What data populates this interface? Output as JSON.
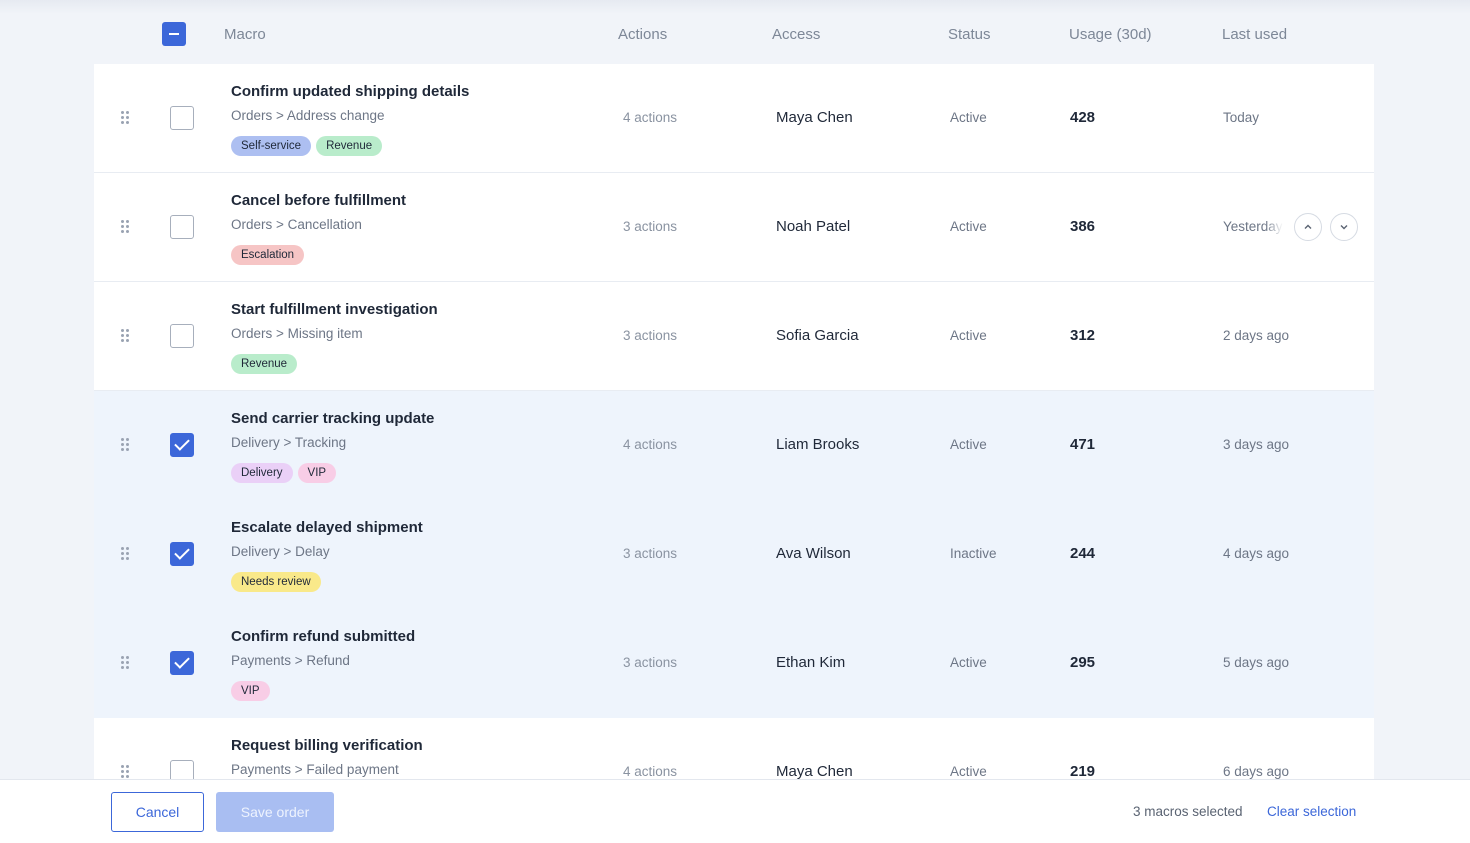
{
  "header": {
    "macro": "Macro",
    "actions": "Actions",
    "access": "Access",
    "status": "Status",
    "usage": "Usage (30d)",
    "last_used": "Last used"
  },
  "colors": {
    "accent": "#3c67d9",
    "selected_row": "#eef4fc"
  },
  "rows": [
    {
      "title": "Confirm updated shipping details",
      "path": "Orders > Address change",
      "tags": [
        {
          "label": "Self-service",
          "color": "#adbff1"
        },
        {
          "label": "Revenue",
          "color": "#b9eccb"
        }
      ],
      "actions": "4 actions",
      "access": "Maya Chen",
      "status": "Active",
      "usage": "428",
      "last": "Today",
      "selected": false
    },
    {
      "title": "Cancel before fulfillment",
      "path": "Orders > Cancellation",
      "tags": [
        {
          "label": "Escalation",
          "color": "#f6c5c5"
        }
      ],
      "actions": "3 actions",
      "access": "Noah Patel",
      "status": "Active",
      "usage": "386",
      "last": "Yesterday",
      "selected": false
    },
    {
      "title": "Start fulfillment investigation",
      "path": "Orders > Missing item",
      "tags": [
        {
          "label": "Revenue",
          "color": "#b9eccb"
        }
      ],
      "actions": "3 actions",
      "access": "Sofia Garcia",
      "status": "Active",
      "usage": "312",
      "last": "2 days ago",
      "selected": false
    },
    {
      "title": "Send carrier tracking update",
      "path": "Delivery > Tracking",
      "tags": [
        {
          "label": "Delivery",
          "color": "#ead0f7"
        },
        {
          "label": "VIP",
          "color": "#f8cde6"
        }
      ],
      "actions": "4 actions",
      "access": "Liam Brooks",
      "status": "Active",
      "usage": "471",
      "last": "3 days ago",
      "selected": true
    },
    {
      "title": "Escalate delayed shipment",
      "path": "Delivery > Delay",
      "tags": [
        {
          "label": "Needs review",
          "color": "#f9e98a"
        }
      ],
      "actions": "3 actions",
      "access": "Ava Wilson",
      "status": "Inactive",
      "usage": "244",
      "last": "4 days ago",
      "selected": true
    },
    {
      "title": "Confirm refund submitted",
      "path": "Payments > Refund",
      "tags": [
        {
          "label": "VIP",
          "color": "#f8cde6"
        }
      ],
      "actions": "3 actions",
      "access": "Ethan Kim",
      "status": "Active",
      "usage": "295",
      "last": "5 days ago",
      "selected": true
    },
    {
      "title": "Request billing verification",
      "path": "Payments > Failed payment",
      "tags": [],
      "actions": "4 actions",
      "access": "Maya Chen",
      "status": "Active",
      "usage": "219",
      "last": "6 days ago",
      "selected": false
    }
  ],
  "footer": {
    "cancel_label": "Cancel",
    "save_label": "Save order",
    "selection_count": "3 macros selected",
    "clear_label": "Clear selection"
  },
  "icons": {
    "drag": "drag-handle-icon",
    "up": "chevron-up-icon",
    "down": "chevron-down-icon"
  }
}
